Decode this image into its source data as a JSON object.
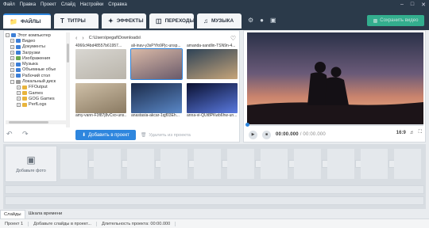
{
  "menu": [
    "Файл",
    "Правка",
    "Проект",
    "Слайд",
    "Настройки",
    "Справка"
  ],
  "tabs": [
    {
      "label": "ФАЙЛЫ",
      "icon": "folder-icon"
    },
    {
      "label": "ТИТРЫ",
      "icon": "text-icon"
    },
    {
      "label": "ЭФФЕКТЫ",
      "icon": "effects-icon"
    },
    {
      "label": "ПЕРЕХОДЫ",
      "icon": "transitions-icon"
    },
    {
      "label": "МУЗЫКА",
      "icon": "music-icon"
    }
  ],
  "save_video": "Сохранить видео",
  "tree": [
    {
      "label": "Этот компьютер",
      "icon": "computer-icon"
    },
    {
      "label": "Видео",
      "icon": "folder-icon"
    },
    {
      "label": "Документы",
      "icon": "folder-icon"
    },
    {
      "label": "Загрузки",
      "icon": "folder-icon"
    },
    {
      "label": "Изображения",
      "icon": "folder-icon"
    },
    {
      "label": "Музыка",
      "icon": "folder-icon"
    },
    {
      "label": "Объемные объе",
      "icon": "folder-icon"
    },
    {
      "label": "Рабочий стол",
      "icon": "folder-icon"
    },
    {
      "label": "Локальный диск",
      "icon": "drive-icon"
    },
    {
      "label": "FFOutput",
      "icon": "folder-icon"
    },
    {
      "label": "Games",
      "icon": "folder-icon"
    },
    {
      "label": "GOG Games",
      "icon": "folder-icon"
    },
    {
      "label": "PerfLogs",
      "icon": "folder-icon"
    }
  ],
  "path": "C:\\Users\\pegaf\\Downloads\\",
  "thumbnails": [
    {
      "caption": "4066cf4bd48557b61957...",
      "colors": [
        "#d9d7d2",
        "#b9b4aa"
      ]
    },
    {
      "caption": "ali-inav-y3sPYfo9Pjc-unsp...",
      "colors": [
        "#d9b9a7",
        "#6a5a6a"
      ]
    },
    {
      "caption": "amanda-sandlin-TSN9n-4...",
      "colors": [
        "#2d4256",
        "#c7a57a"
      ]
    },
    {
      "caption": "amy-vann-F3f87j8vCxo-uns...",
      "colors": [
        "#cfc0a8",
        "#8a7a62"
      ]
    },
    {
      "caption": "anastasia-akcar-1qjf03Eh...",
      "colors": [
        "#1b2a48",
        "#5a88c8"
      ]
    },
    {
      "caption": "anna-vi-QUt8PKwb6hw-un...",
      "colors": [
        "#0a1030",
        "#5a7ae0"
      ]
    }
  ],
  "add_to_project": "Добавить в проект",
  "remove_from_project": "Удалить из проекта",
  "player": {
    "time": "00:00.000",
    "total": "/ 00:00.000",
    "aspect": "16:9"
  },
  "add_photo": "Добавьте фото",
  "bottom_tabs": [
    "Слайды",
    "Шкала времени"
  ],
  "status": [
    "Проект 1",
    "Добавьте слайды в проект...",
    "Длительность проекта: 00:00.000"
  ],
  "colors": {
    "accent": "#2e86de",
    "save": "#35c39a",
    "chrome": "#2b3a4a"
  }
}
